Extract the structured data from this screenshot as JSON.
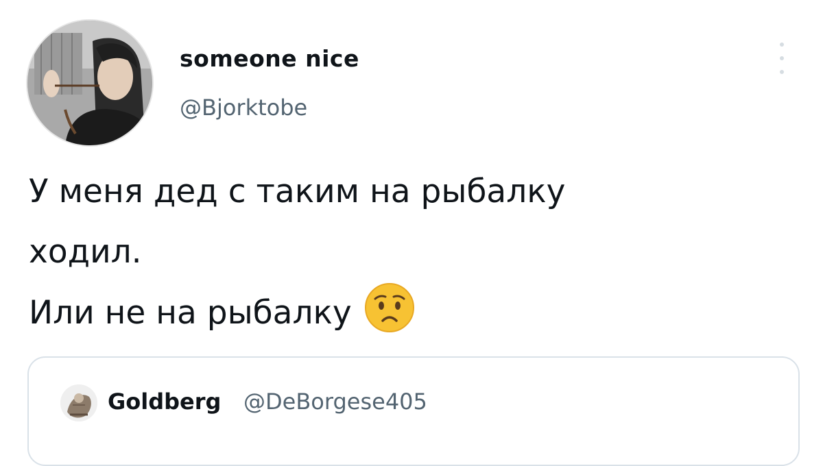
{
  "tweet": {
    "author": {
      "display_name": "someone nice",
      "handle": "@Bjorktobe",
      "avatar": "profile-photo"
    },
    "more_icon": "more-vertical-icon",
    "text_lines": [
      "У меня дед с таким на рыбалку",
      "ходил.",
      "Или не на рыбалку"
    ],
    "emoji": "worried-face-emoji",
    "quoted": {
      "display_name": "Goldberg",
      "handle": "@DeBorgese405",
      "avatar": "profile-photo"
    }
  },
  "colors": {
    "text_primary": "#0f1419",
    "text_secondary": "#536471",
    "border": "#d9e1e8",
    "emoji_yellow": "#f7c233"
  }
}
